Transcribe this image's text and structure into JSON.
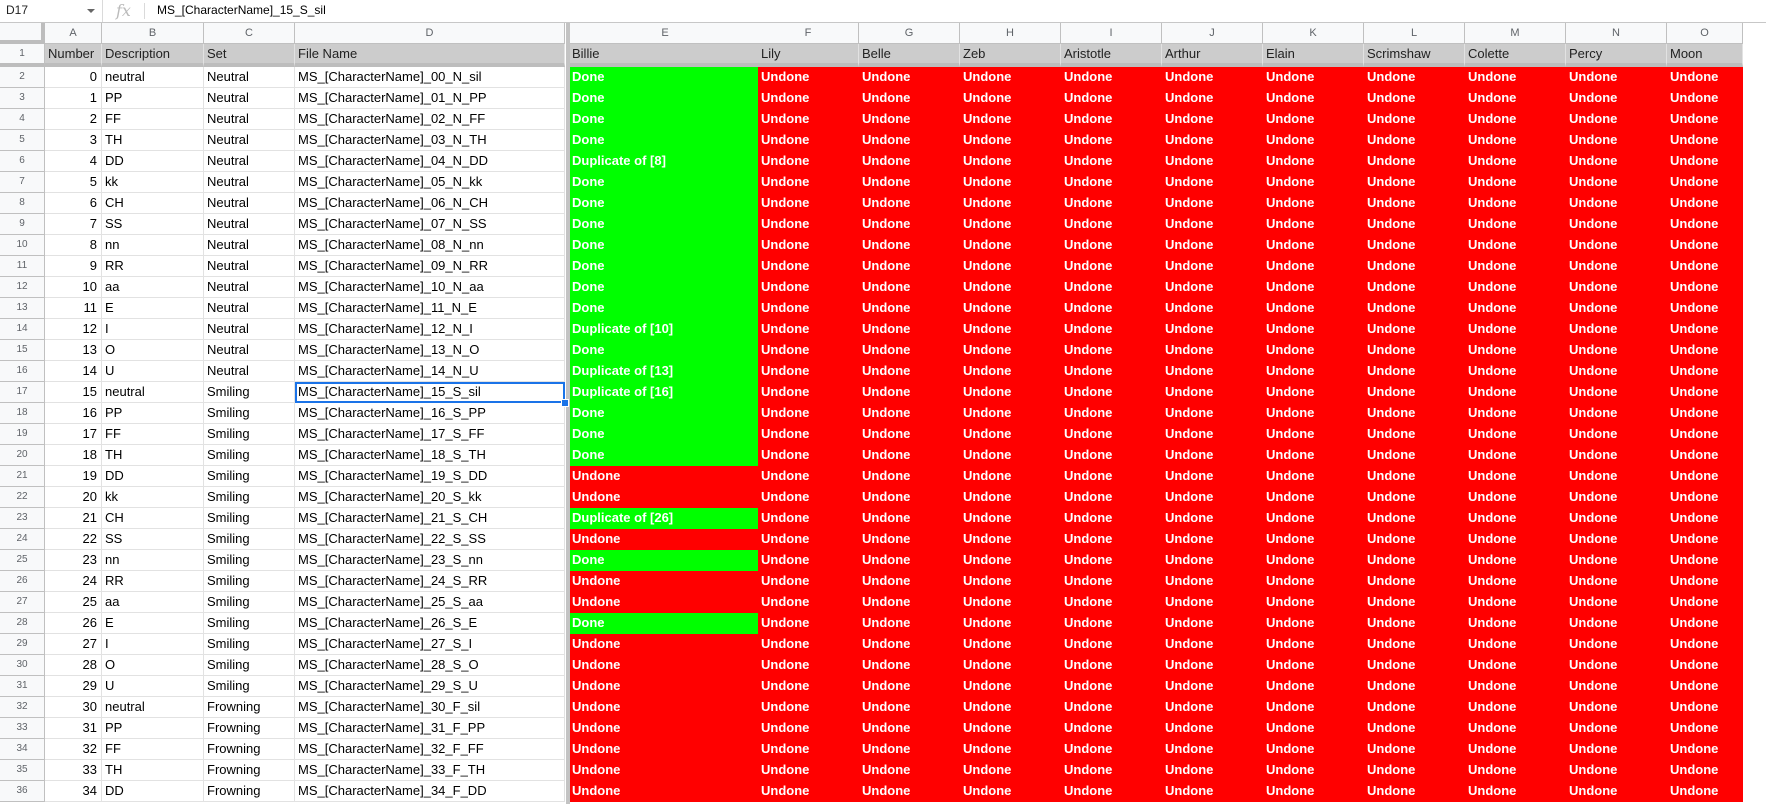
{
  "formula_bar": {
    "name_box": "D17",
    "fx_icon": "fx",
    "content": "MS_[CharacterName]_15_S_sil"
  },
  "selected_cell": {
    "row": 17,
    "col": "D"
  },
  "columns": [
    "A",
    "B",
    "C",
    "D",
    "E",
    "F",
    "G",
    "H",
    "I",
    "J",
    "K",
    "L",
    "M",
    "N",
    "O"
  ],
  "headers": [
    "Number",
    "Description",
    "Set",
    "File Name",
    "Billie",
    "Lily",
    "Belle",
    "Zeb",
    "Aristotle",
    "Arthur",
    "Elain",
    "Scrimshaw",
    "Colette",
    "Percy",
    "Moon"
  ],
  "other_characters_status": "Undone",
  "colors": {
    "done": "#00ff00",
    "undone": "#ff0000",
    "header_bg": "#cccccc",
    "selection": "#1a73e8"
  },
  "rows": [
    {
      "n": "0",
      "desc": "neutral",
      "set": "Neutral",
      "file": "MS_[CharacterName]_00_N_sil",
      "billie": "Done"
    },
    {
      "n": "1",
      "desc": "PP",
      "set": "Neutral",
      "file": "MS_[CharacterName]_01_N_PP",
      "billie": "Done"
    },
    {
      "n": "2",
      "desc": "FF",
      "set": "Neutral",
      "file": "MS_[CharacterName]_02_N_FF",
      "billie": "Done"
    },
    {
      "n": "3",
      "desc": "TH",
      "set": "Neutral",
      "file": "MS_[CharacterName]_03_N_TH",
      "billie": "Done"
    },
    {
      "n": "4",
      "desc": "DD",
      "set": "Neutral",
      "file": "MS_[CharacterName]_04_N_DD",
      "billie": "Duplicate of [8]"
    },
    {
      "n": "5",
      "desc": "kk",
      "set": "Neutral",
      "file": "MS_[CharacterName]_05_N_kk",
      "billie": "Done"
    },
    {
      "n": "6",
      "desc": "CH",
      "set": "Neutral",
      "file": "MS_[CharacterName]_06_N_CH",
      "billie": "Done"
    },
    {
      "n": "7",
      "desc": "SS",
      "set": "Neutral",
      "file": "MS_[CharacterName]_07_N_SS",
      "billie": "Done"
    },
    {
      "n": "8",
      "desc": "nn",
      "set": "Neutral",
      "file": "MS_[CharacterName]_08_N_nn",
      "billie": "Done"
    },
    {
      "n": "9",
      "desc": "RR",
      "set": "Neutral",
      "file": "MS_[CharacterName]_09_N_RR",
      "billie": "Done"
    },
    {
      "n": "10",
      "desc": "aa",
      "set": "Neutral",
      "file": "MS_[CharacterName]_10_N_aa",
      "billie": "Done"
    },
    {
      "n": "11",
      "desc": "E",
      "set": "Neutral",
      "file": "MS_[CharacterName]_11_N_E",
      "billie": "Done"
    },
    {
      "n": "12",
      "desc": "I",
      "set": "Neutral",
      "file": "MS_[CharacterName]_12_N_I",
      "billie": "Duplicate of [10]"
    },
    {
      "n": "13",
      "desc": "O",
      "set": "Neutral",
      "file": "MS_[CharacterName]_13_N_O",
      "billie": "Done"
    },
    {
      "n": "14",
      "desc": "U",
      "set": "Neutral",
      "file": "MS_[CharacterName]_14_N_U",
      "billie": "Duplicate of [13]"
    },
    {
      "n": "15",
      "desc": "neutral",
      "set": "Smiling",
      "file": "MS_[CharacterName]_15_S_sil",
      "billie": "Duplicate of [16]"
    },
    {
      "n": "16",
      "desc": "PP",
      "set": "Smiling",
      "file": "MS_[CharacterName]_16_S_PP",
      "billie": "Done"
    },
    {
      "n": "17",
      "desc": "FF",
      "set": "Smiling",
      "file": "MS_[CharacterName]_17_S_FF",
      "billie": "Done"
    },
    {
      "n": "18",
      "desc": "TH",
      "set": "Smiling",
      "file": "MS_[CharacterName]_18_S_TH",
      "billie": "Done"
    },
    {
      "n": "19",
      "desc": "DD",
      "set": "Smiling",
      "file": "MS_[CharacterName]_19_S_DD",
      "billie": "Undone"
    },
    {
      "n": "20",
      "desc": "kk",
      "set": "Smiling",
      "file": "MS_[CharacterName]_20_S_kk",
      "billie": "Undone"
    },
    {
      "n": "21",
      "desc": "CH",
      "set": "Smiling",
      "file": "MS_[CharacterName]_21_S_CH",
      "billie": "Duplicate of [26]"
    },
    {
      "n": "22",
      "desc": "SS",
      "set": "Smiling",
      "file": "MS_[CharacterName]_22_S_SS",
      "billie": "Undone"
    },
    {
      "n": "23",
      "desc": "nn",
      "set": "Smiling",
      "file": "MS_[CharacterName]_23_S_nn",
      "billie": "Done"
    },
    {
      "n": "24",
      "desc": "RR",
      "set": "Smiling",
      "file": "MS_[CharacterName]_24_S_RR",
      "billie": "Undone"
    },
    {
      "n": "25",
      "desc": "aa",
      "set": "Smiling",
      "file": "MS_[CharacterName]_25_S_aa",
      "billie": "Undone"
    },
    {
      "n": "26",
      "desc": "E",
      "set": "Smiling",
      "file": "MS_[CharacterName]_26_S_E",
      "billie": "Done"
    },
    {
      "n": "27",
      "desc": "I",
      "set": "Smiling",
      "file": "MS_[CharacterName]_27_S_I",
      "billie": "Undone"
    },
    {
      "n": "28",
      "desc": "O",
      "set": "Smiling",
      "file": "MS_[CharacterName]_28_S_O",
      "billie": "Undone"
    },
    {
      "n": "29",
      "desc": "U",
      "set": "Smiling",
      "file": "MS_[CharacterName]_29_S_U",
      "billie": "Undone"
    },
    {
      "n": "30",
      "desc": "neutral",
      "set": "Frowning",
      "file": "MS_[CharacterName]_30_F_sil",
      "billie": "Undone"
    },
    {
      "n": "31",
      "desc": "PP",
      "set": "Frowning",
      "file": "MS_[CharacterName]_31_F_PP",
      "billie": "Undone"
    },
    {
      "n": "32",
      "desc": "FF",
      "set": "Frowning",
      "file": "MS_[CharacterName]_32_F_FF",
      "billie": "Undone"
    },
    {
      "n": "33",
      "desc": "TH",
      "set": "Frowning",
      "file": "MS_[CharacterName]_33_F_TH",
      "billie": "Undone"
    },
    {
      "n": "34",
      "desc": "DD",
      "set": "Frowning",
      "file": "MS_[CharacterName]_34_F_DD",
      "billie": "Undone"
    }
  ]
}
